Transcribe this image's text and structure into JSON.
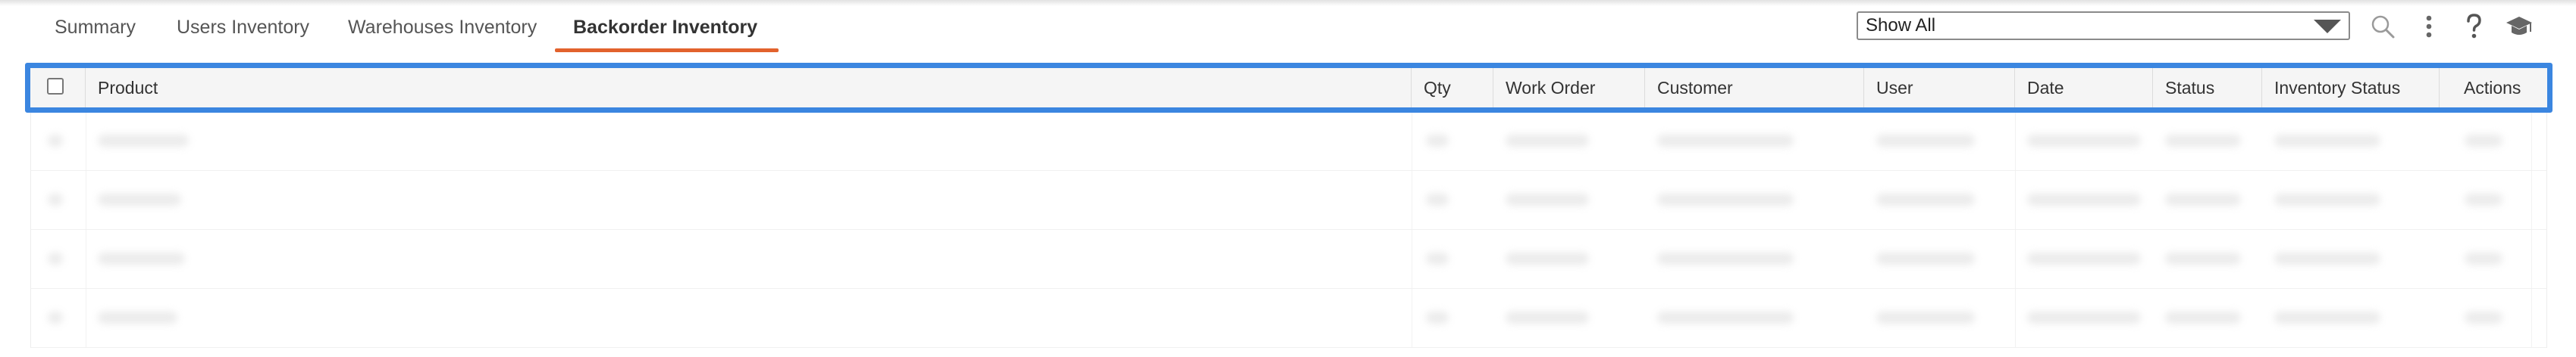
{
  "tabs": [
    {
      "label": "Summary"
    },
    {
      "label": "Users Inventory"
    },
    {
      "label": "Warehouses Inventory"
    },
    {
      "label": "Backorder Inventory"
    }
  ],
  "active_tab": "Backorder Inventory",
  "filter": {
    "selected": "Show All"
  },
  "toolbar": {
    "icons": [
      "search-icon",
      "more-vertical-icon",
      "help-icon",
      "graduation-cap-icon"
    ]
  },
  "table": {
    "columns": [
      "Product",
      "Qty",
      "Work Order",
      "Customer",
      "User",
      "Date",
      "Status",
      "Inventory Status",
      "Actions"
    ]
  },
  "colors": {
    "accent": "#e2622d",
    "highlight": "#3b86e0"
  }
}
